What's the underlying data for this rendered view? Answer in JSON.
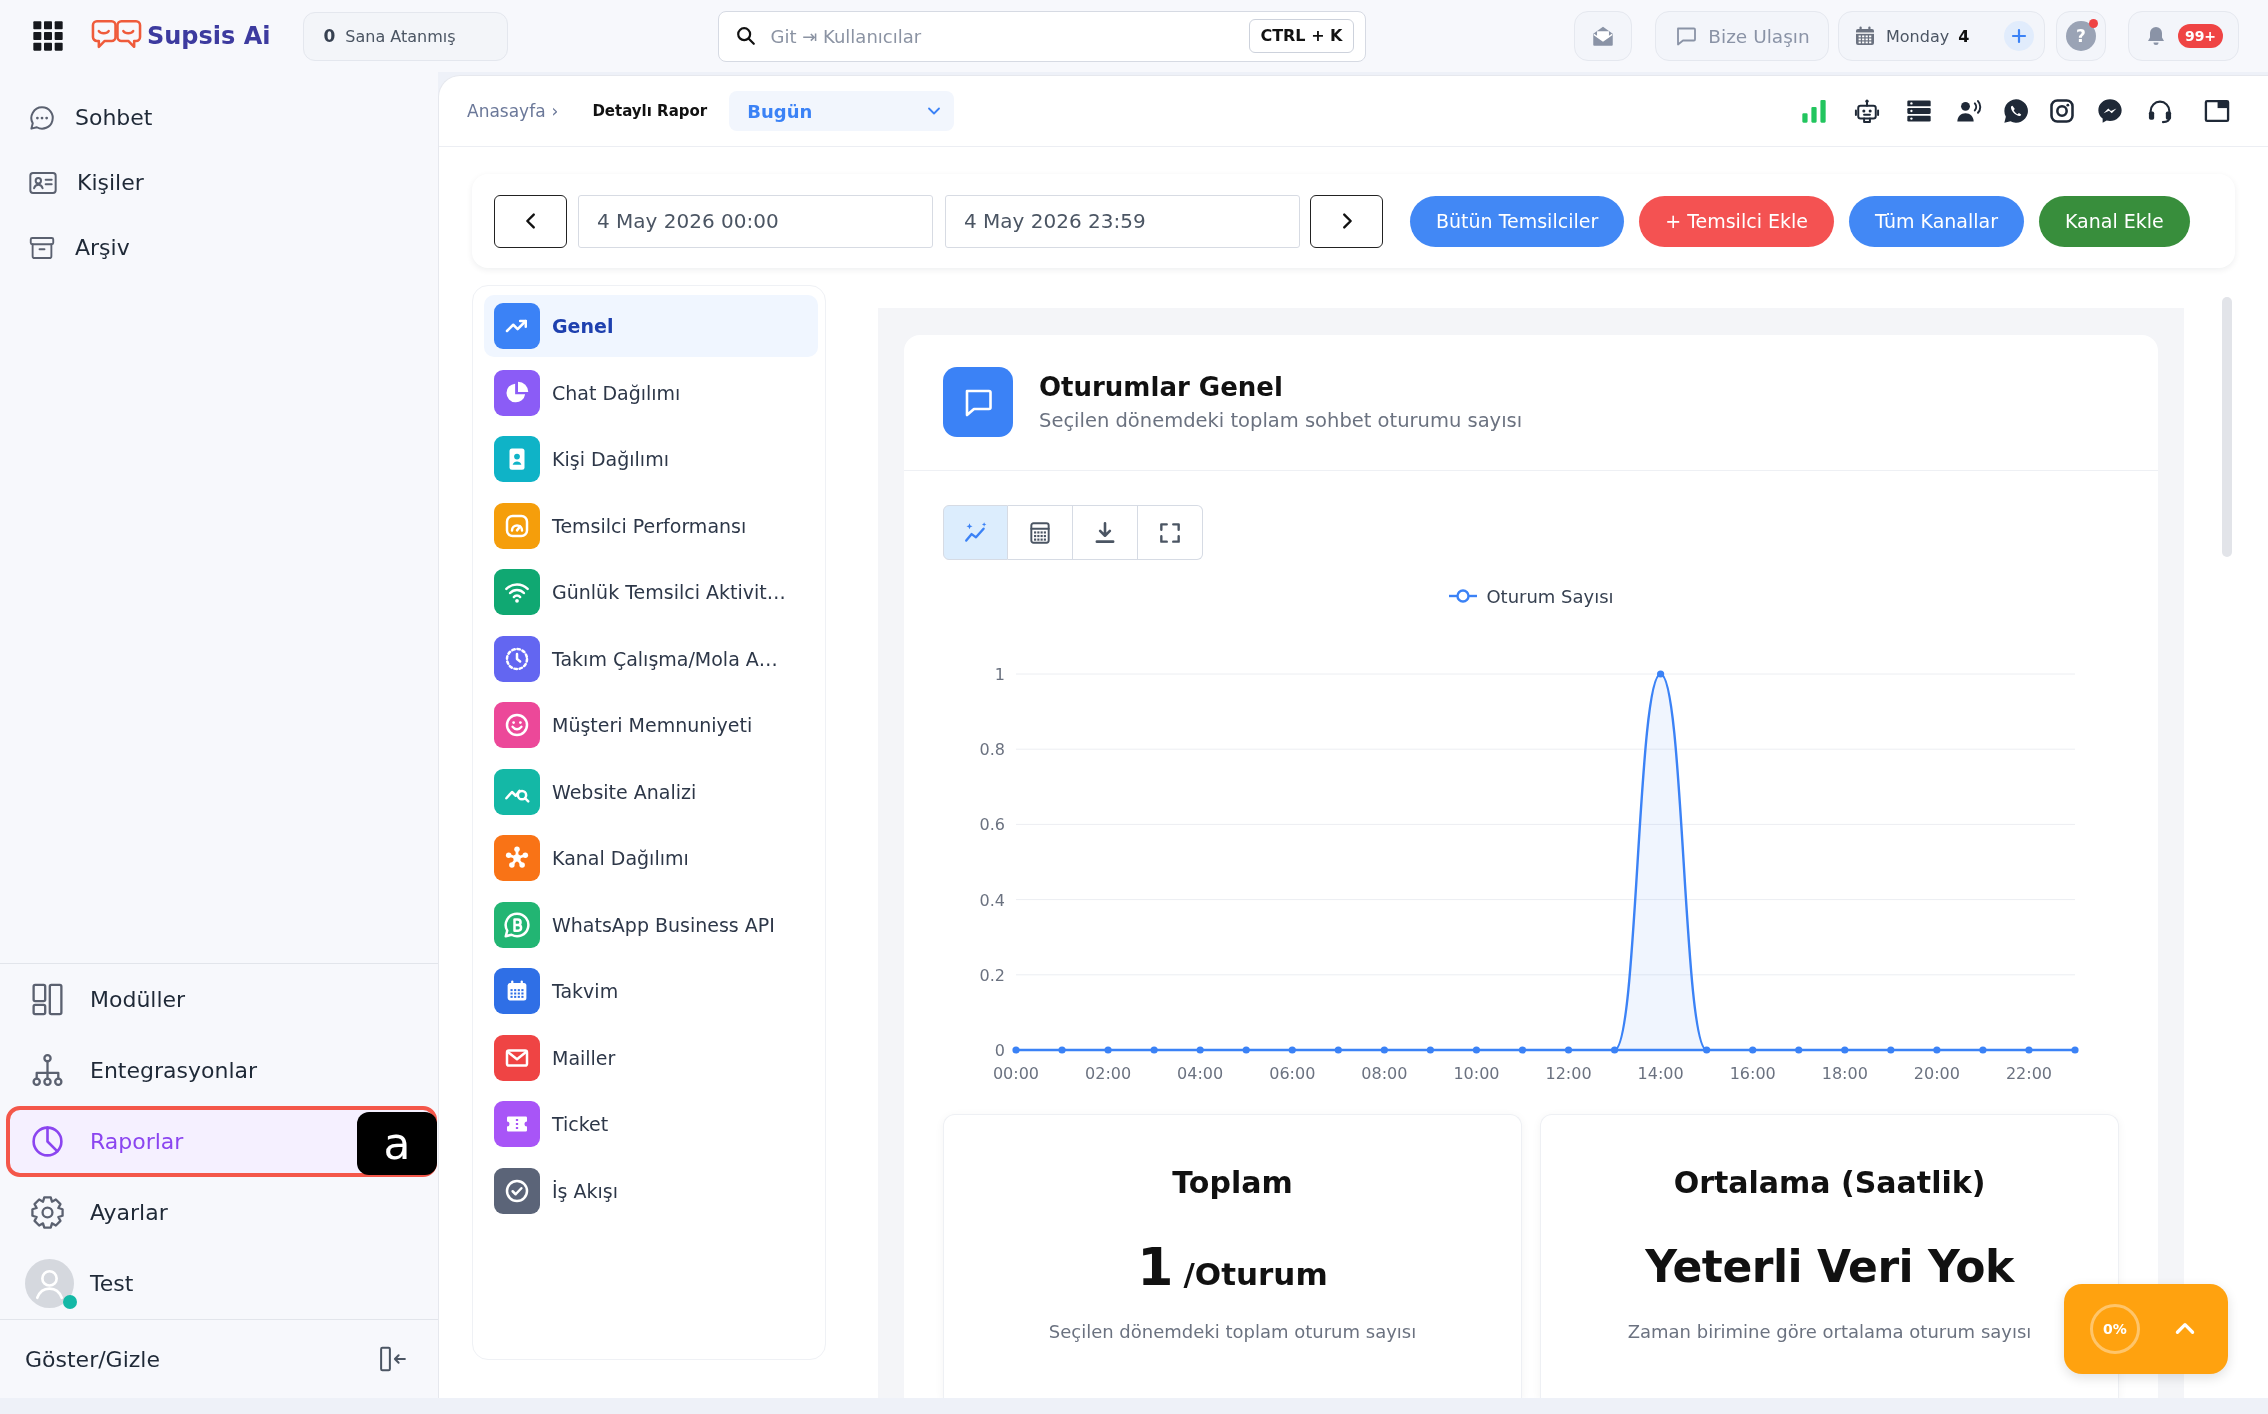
{
  "topbar": {
    "logo": "Supsis Ai",
    "assigned": {
      "count": "0",
      "label": "Sana Atanmış"
    },
    "search": {
      "placeholder": "Git ⇥ Kullanıcılar",
      "shortcut": "CTRL + K"
    },
    "contact": "Bize Ulaşın",
    "calendar": {
      "day": "Monday",
      "date": "4"
    },
    "help": {
      "symbol": "?",
      "dot": true
    },
    "notifications": {
      "badge": "99+"
    }
  },
  "sidebar": {
    "top_items": [
      {
        "label": "Sohbet",
        "selected": false
      },
      {
        "label": "Kişiler",
        "selected": false
      },
      {
        "label": "Arşiv",
        "selected": false
      }
    ],
    "bottom_items": [
      {
        "label": "Modüller",
        "selected": false,
        "highlighted": false
      },
      {
        "label": "Entegrasyonlar",
        "selected": false,
        "highlighted": false
      },
      {
        "label": "Raporlar",
        "selected": true,
        "highlighted": true,
        "hint": "a"
      },
      {
        "label": "Ayarlar",
        "selected": false,
        "highlighted": false
      }
    ],
    "user": {
      "name": "Test",
      "online": true
    },
    "toggle": "Göster/Gizle"
  },
  "breadcrumb": {
    "items": [
      "Anasayfa",
      "Detaylı Rapor"
    ],
    "separator": "›"
  },
  "period_select": {
    "value": "Bugün"
  },
  "date_range": {
    "start": "4 May 2026 00:00",
    "end": "4 May 2026 23:59"
  },
  "actions": [
    {
      "label": "Bütün Temsilciler",
      "kind": "primary"
    },
    {
      "label": "+ Temsilci Ekle",
      "kind": "danger"
    },
    {
      "label": "Tüm Kanallar",
      "kind": "primary"
    },
    {
      "label": "Kanal Ekle",
      "kind": "success"
    }
  ],
  "report_menu": [
    {
      "label": "Genel",
      "selected": true,
      "color": "#3b82f6"
    },
    {
      "label": "Chat Dağılımı",
      "selected": false,
      "color": "#8b5cf6"
    },
    {
      "label": "Kişi Dağılımı",
      "selected": false,
      "color": "#0fb3c7"
    },
    {
      "label": "Temsilci Performansı",
      "selected": false,
      "color": "#f59e0b"
    },
    {
      "label": "Günlük Temsilci Aktivit…",
      "selected": false,
      "color": "#10a872"
    },
    {
      "label": "Takım Çalışma/Mola A…",
      "selected": false,
      "color": "#6366f1"
    },
    {
      "label": "Müşteri Memnuniyeti",
      "selected": false,
      "color": "#ec4899"
    },
    {
      "label": "Website Analizi",
      "selected": false,
      "color": "#14b8a6"
    },
    {
      "label": "Kanal Dağılımı",
      "selected": false,
      "color": "#f97316"
    },
    {
      "label": "WhatsApp Business API",
      "selected": false,
      "color": "#22b573"
    },
    {
      "label": "Takvim",
      "selected": false,
      "color": "#2f6fe6"
    },
    {
      "label": "Mailler",
      "selected": false,
      "color": "#ef4444"
    },
    {
      "label": "Ticket",
      "selected": false,
      "color": "#a855f7"
    },
    {
      "label": "İş Akışı",
      "selected": false,
      "color": "#5b6478"
    }
  ],
  "chart_card": {
    "title": "Oturumlar Genel",
    "subtitle": "Seçilen dönemdeki toplam sohbet oturumu sayısı",
    "view_buttons": [
      {
        "selected": true
      },
      {
        "selected": false
      },
      {
        "selected": false
      },
      {
        "selected": false
      }
    ],
    "chart_data": {
      "type": "area",
      "x": [
        0,
        1,
        2,
        3,
        4,
        5,
        6,
        7,
        8,
        9,
        10,
        11,
        12,
        13,
        14,
        15,
        16,
        17,
        18,
        19,
        20,
        21,
        22,
        23
      ],
      "series": [
        {
          "name": "Oturum Sayısı",
          "color": "#3b82f6",
          "values": [
            0,
            0,
            0,
            0,
            0,
            0,
            0,
            0,
            0,
            0,
            0,
            0,
            0,
            0,
            1,
            0,
            0,
            0,
            0,
            0,
            0,
            0,
            0,
            0
          ]
        }
      ],
      "xlim": [
        0,
        23
      ],
      "ylim": [
        0,
        1
      ],
      "xticks": [
        {
          "value": 0,
          "label": "00:00"
        },
        {
          "value": 2,
          "label": "02:00"
        },
        {
          "value": 4,
          "label": "04:00"
        },
        {
          "value": 6,
          "label": "06:00"
        },
        {
          "value": 8,
          "label": "08:00"
        },
        {
          "value": 10,
          "label": "10:00"
        },
        {
          "value": 12,
          "label": "12:00"
        },
        {
          "value": 14,
          "label": "14:00"
        },
        {
          "value": 16,
          "label": "16:00"
        },
        {
          "value": 18,
          "label": "18:00"
        },
        {
          "value": 20,
          "label": "20:00"
        },
        {
          "value": 22,
          "label": "22:00"
        }
      ],
      "yticks": [
        0,
        0.2,
        0.4,
        0.6,
        0.8,
        1
      ],
      "grid": true
    }
  },
  "stats": [
    {
      "title": "Toplam",
      "value": "1",
      "unit": "/Oturum",
      "caption": "Seçilen dönemdeki toplam oturum sayısı"
    },
    {
      "title": "Ortalama (Saatlik)",
      "value": "Yeterli Veri Yok",
      "caption": "Zaman birimine göre ortalama oturum sayısı"
    }
  ],
  "progress_widget": {
    "label": "0%"
  }
}
